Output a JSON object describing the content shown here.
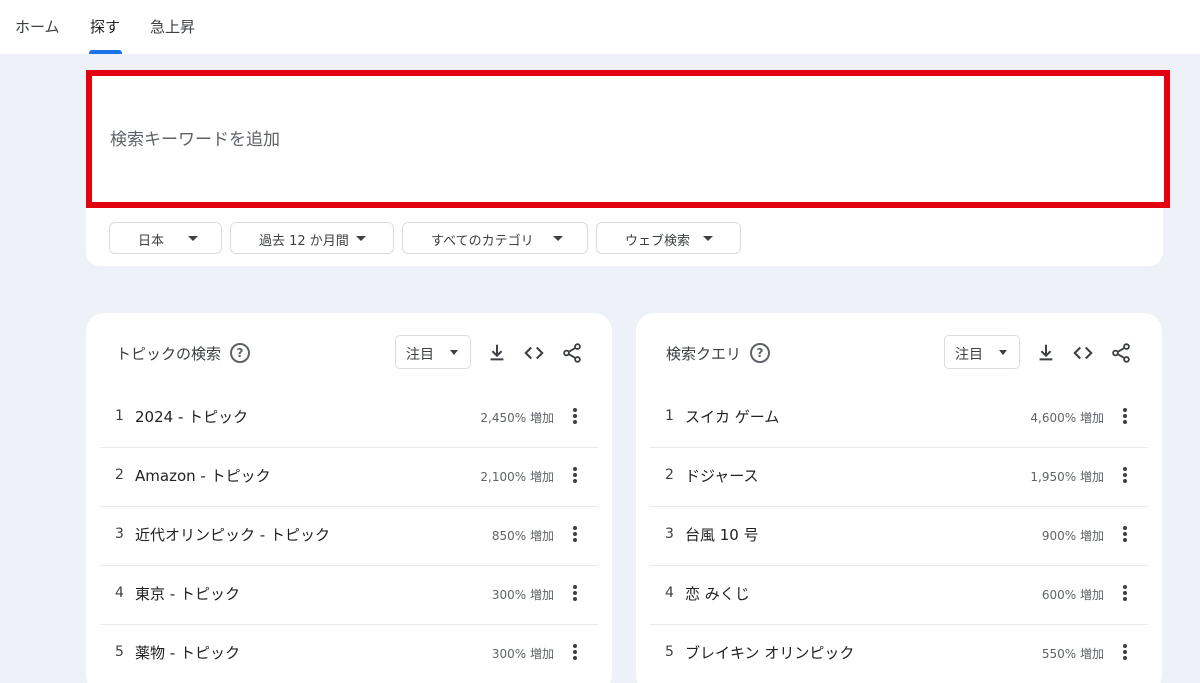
{
  "nav": {
    "tabs": [
      {
        "label": "ホーム"
      },
      {
        "label": "探す"
      },
      {
        "label": "急上昇"
      }
    ]
  },
  "search": {
    "placeholder": "検索キーワードを追加",
    "highlight_color": "#e3000f"
  },
  "filters": [
    {
      "label": "日本"
    },
    {
      "label": "過去 12 か月間"
    },
    {
      "label": "すべてのカテゴリ"
    },
    {
      "label": "ウェブ検索"
    }
  ],
  "panels": [
    {
      "title": "トピックの検索",
      "select": "注目",
      "rows": [
        {
          "rank": "1",
          "name": "2024 - トピック",
          "value": "2,450% 増加"
        },
        {
          "rank": "2",
          "name": "Amazon - トピック",
          "value": "2,100% 増加"
        },
        {
          "rank": "3",
          "name": "近代オリンピック - トピック",
          "value": "850% 増加"
        },
        {
          "rank": "4",
          "name": "東京 - トピック",
          "value": "300% 増加"
        },
        {
          "rank": "5",
          "name": "薬物 - トピック",
          "value": "300% 増加"
        }
      ]
    },
    {
      "title": "検索クエリ",
      "select": "注目",
      "rows": [
        {
          "rank": "1",
          "name": "スイカ ゲーム",
          "value": "4,600% 増加"
        },
        {
          "rank": "2",
          "name": "ドジャース",
          "value": "1,950% 増加"
        },
        {
          "rank": "3",
          "name": "台風 10 号",
          "value": "900% 増加"
        },
        {
          "rank": "4",
          "name": "恋 みくじ",
          "value": "600% 増加"
        },
        {
          "rank": "5",
          "name": "ブレイキン オリンピック",
          "value": "550% 増加"
        }
      ]
    }
  ],
  "icons": {
    "help": "help-circle-icon",
    "download": "download-icon",
    "embed": "code-embed-icon",
    "share": "share-icon",
    "more": "more-vert-icon",
    "dropdown": "caret-down-icon"
  },
  "colors": {
    "accent": "#1a73e8",
    "background": "#eef1f8"
  }
}
